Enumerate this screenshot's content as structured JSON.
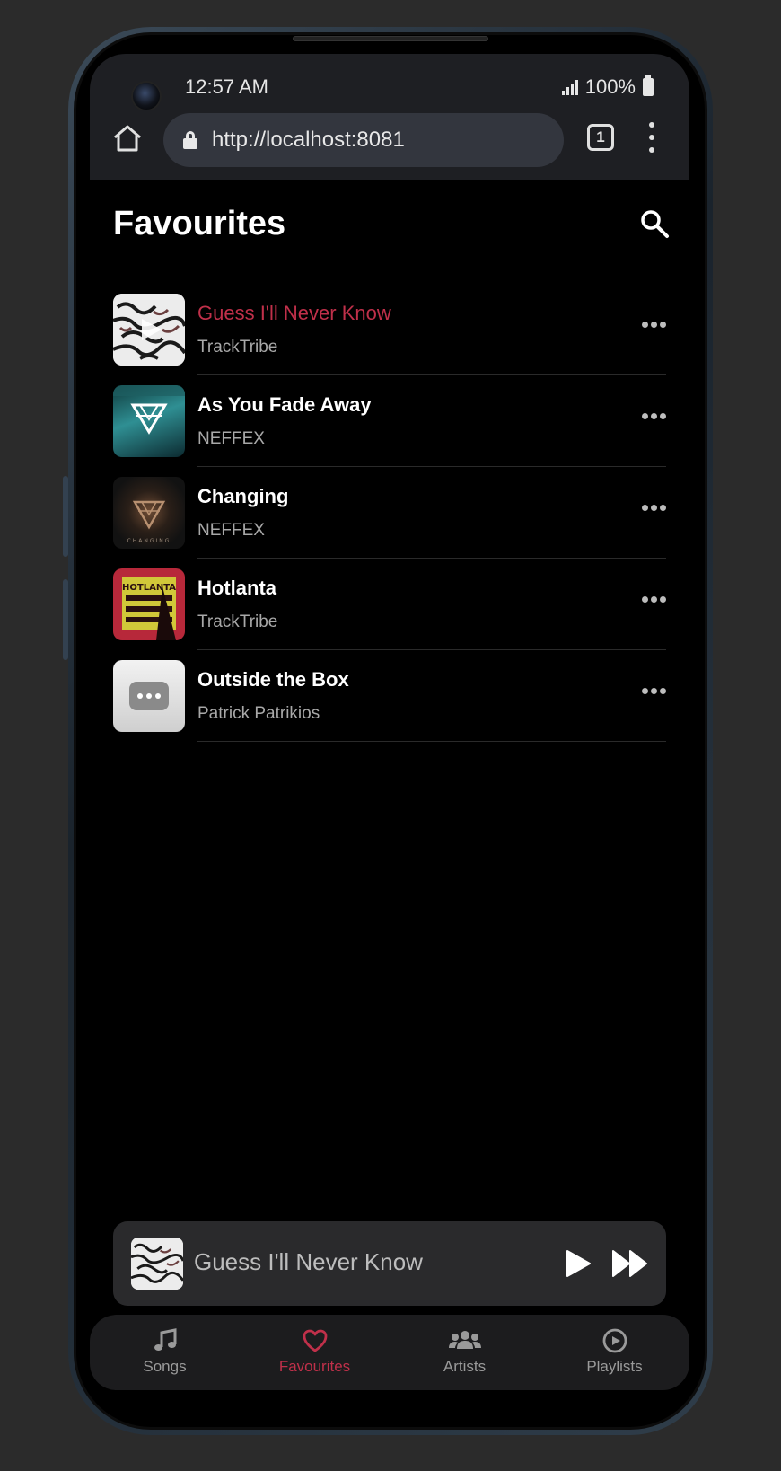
{
  "status_bar": {
    "time": "12:57 AM",
    "battery": "100%"
  },
  "browser": {
    "url": "http://localhost:8081",
    "tab_count": "1"
  },
  "page": {
    "title": "Favourites"
  },
  "songs": [
    {
      "title": "Guess I'll Never Know",
      "artist": "TrackTribe",
      "active": true,
      "art": "white-abstract-art"
    },
    {
      "title": "As You Fade Away",
      "artist": "NEFFEX",
      "active": false,
      "art": "teal-neffex-art"
    },
    {
      "title": "Changing",
      "artist": "NEFFEX",
      "active": false,
      "art": "dark-neffex-art",
      "art_text": "CHANGING"
    },
    {
      "title": "Hotlanta",
      "artist": "TrackTribe",
      "active": false,
      "art": "red-hotlanta-art",
      "art_text": "HOTLANTA"
    },
    {
      "title": "Outside the Box",
      "artist": "Patrick Patrikios",
      "active": false,
      "art": "placeholder-art"
    }
  ],
  "mini_player": {
    "title": "Guess I'll Never Know"
  },
  "nav": [
    {
      "label": "Songs",
      "icon": "music-note-icon",
      "active": false
    },
    {
      "label": "Favourites",
      "icon": "heart-icon",
      "active": true
    },
    {
      "label": "Artists",
      "icon": "people-icon",
      "active": false
    },
    {
      "label": "Playlists",
      "icon": "play-circle-icon",
      "active": false
    }
  ],
  "colors": {
    "accent": "#c0304a",
    "background": "#000000",
    "surface": "#2a2a2c"
  }
}
